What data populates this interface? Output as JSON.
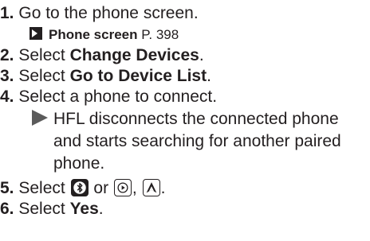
{
  "steps": [
    {
      "num": "1.",
      "text": "Go to the phone screen."
    },
    {
      "num": "2.",
      "prefix": "Select ",
      "bold": "Change Devices",
      "suffix": "."
    },
    {
      "num": "3.",
      "prefix": "Select ",
      "bold": "Go to Device List",
      "suffix": "."
    },
    {
      "num": "4.",
      "text": "Select a phone to connect."
    },
    {
      "num": "5.",
      "prefix": "Select ",
      "mid": " or ",
      "sep": ", ",
      "suffix": "."
    },
    {
      "num": "6.",
      "prefix": "Select ",
      "bold": "Yes",
      "suffix": "."
    }
  ],
  "reference": {
    "title": "Phone screen",
    "page": "P. 398"
  },
  "result_lines": [
    "HFL disconnects the connected phone",
    "and starts searching for another paired",
    "phone."
  ],
  "icons": {
    "arrow": "reference-arrow-icon",
    "result": "result-triangle-icon",
    "bluetooth": "bluetooth-icon",
    "play": "play-icon",
    "navigation": "navigation-icon"
  }
}
